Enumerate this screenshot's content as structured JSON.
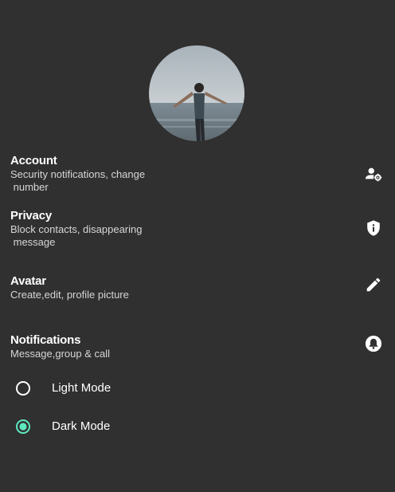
{
  "colors": {
    "background": "#303030",
    "text": "#ffffff",
    "subtext": "#d6d6d6",
    "accent": "#5ee8c0"
  },
  "profile": {
    "avatar_icon": "profile-photo"
  },
  "settings": [
    {
      "id": "account",
      "title": "Account",
      "subtitle": "Security notifications, change\n number",
      "icon": "manage-account-icon"
    },
    {
      "id": "privacy",
      "title": "Privacy",
      "subtitle": "Block contacts, disappearing\n message",
      "icon": "shield-info-icon"
    },
    {
      "id": "avatar",
      "title": "Avatar",
      "subtitle": "Create,edit, profile picture",
      "icon": "pencil-icon"
    },
    {
      "id": "notifications",
      "title": "Notifications",
      "subtitle": "Message,group & call",
      "icon": "bell-icon"
    }
  ],
  "theme": {
    "options": [
      {
        "label": "Light Mode",
        "selected": false
      },
      {
        "label": "Dark Mode",
        "selected": true
      }
    ]
  }
}
